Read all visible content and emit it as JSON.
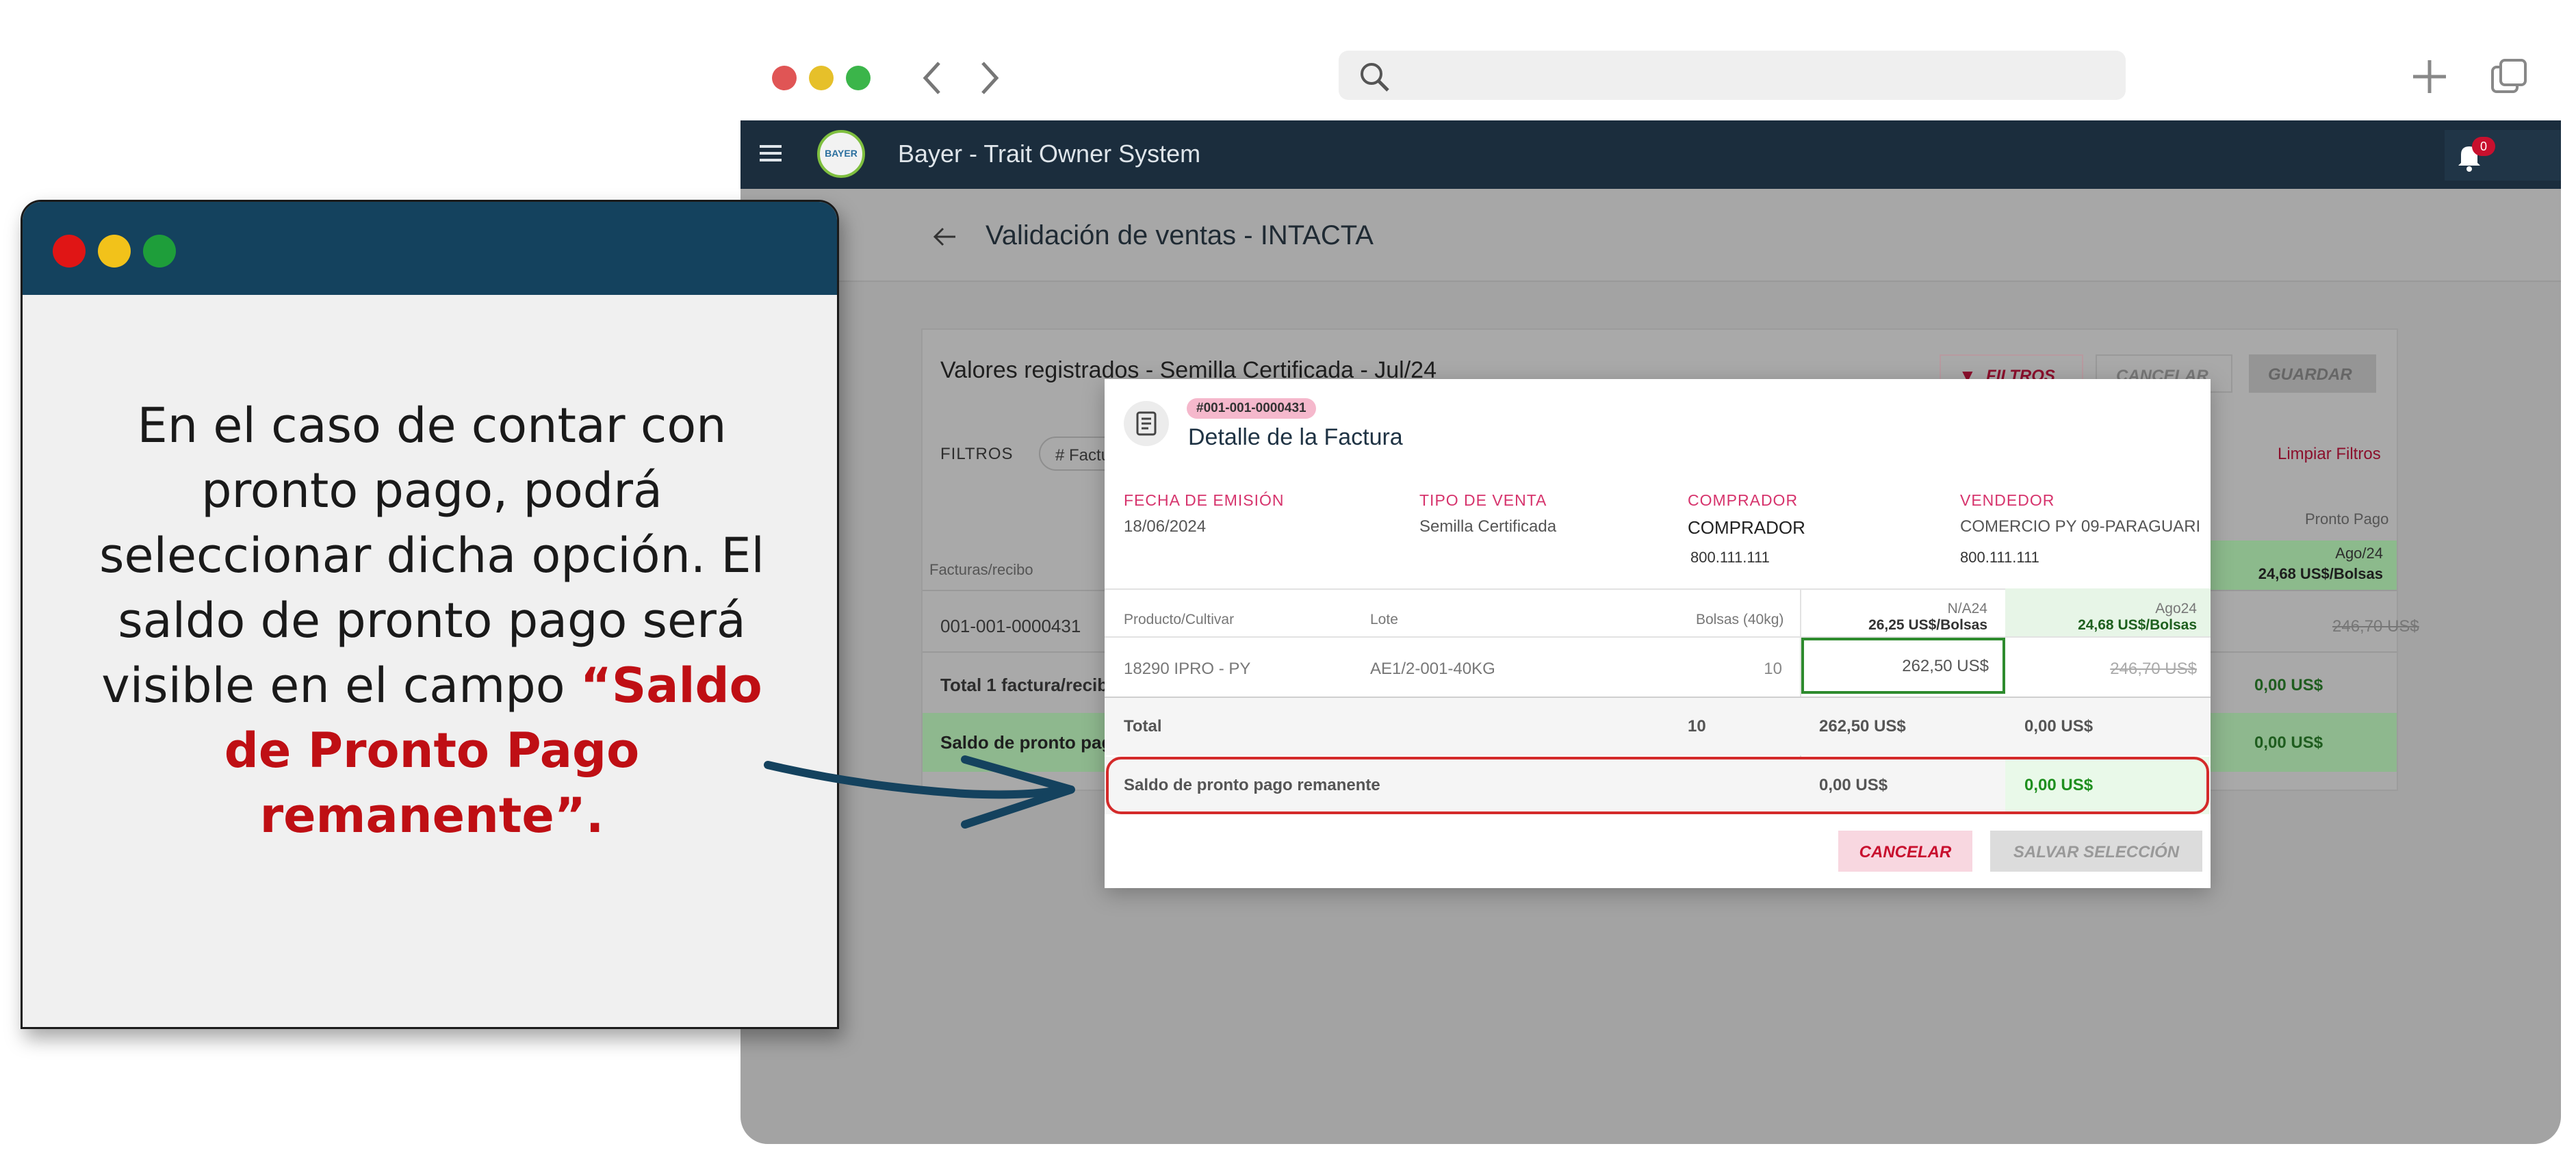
{
  "tutorial": {
    "text": "En el caso de contar con pronto pago, podrá seleccionar dicha opción. El saldo de pronto pago será visible en el campo",
    "highlight": "“Saldo de Pronto Pago remanente”."
  },
  "app": {
    "title": "Bayer - Trait Owner System",
    "logo_text": "BAYER",
    "notification_count": "0"
  },
  "page": {
    "title": "Validación de ventas - INTACTA"
  },
  "background_card": {
    "title": "Valores registrados - Semilla Certificada - Jul/24",
    "filtros_button": "FILTROS",
    "cancelar_button": "CANCELAR",
    "guardar_button": "GUARDAR",
    "filters_label": "FILTROS",
    "filter_chip": "# Factu",
    "limpiar_filtros": "Limpiar Filtros",
    "pronto_pago_header": "Pronto Pago",
    "ago_header": "Ago/24",
    "ago_rate": "24,68 US$/Bolsas",
    "facturas_header": "Facturas/recibo",
    "row_invoice": "001-001-0000431",
    "row_value": "246,70 US$",
    "total_label": "Total 1 factura/recibo",
    "total_value": "0,00 US$",
    "saldo_label": "Saldo de pronto pago",
    "saldo_value": "0,00 US$"
  },
  "modal": {
    "invoice_badge": "#001-001-0000431",
    "title": "Detalle de la Factura",
    "fields": {
      "fecha_label": "FECHA DE EMISIÓN",
      "fecha_value": "18/06/2024",
      "tipo_label": "TIPO DE VENTA",
      "tipo_value": "Semilla Certificada",
      "comprador_label": "COMPRADOR",
      "comprador_value": "COMPRADOR",
      "comprador_id": "800.111.111",
      "vendedor_label": "VENDEDOR",
      "vendedor_value": "COMERCIO PY 09-PARAGUARI",
      "vendedor_id": "800.111.111"
    },
    "table": {
      "col_producto": "Producto/Cultivar",
      "col_lote": "Lote",
      "col_bolsas": "Bolsas (40kg)",
      "col_na24": "N/A24",
      "col_na24_rate": "26,25 US$/Bolsas",
      "col_ago24": "Ago24",
      "col_ago24_rate": "24,68 US$/Bolsas",
      "row_producto": "18290 IPRO - PY",
      "row_lote": "AE1/2-001-40KG",
      "row_bolsas": "10",
      "row_na24": "262,50 US$",
      "row_ago24": "246,70 US$",
      "total_label": "Total",
      "total_bolsas": "10",
      "total_na24": "262,50 US$",
      "total_ago24": "0,00 US$",
      "saldo_label": "Saldo de pronto pago remanente",
      "saldo_na24": "0,00 US$",
      "saldo_ago24": "0,00 US$"
    },
    "cancel_button": "CANCELAR",
    "save_button": "SALVAR SELECCIÓN"
  },
  "colors": {
    "appbar": "#1b2d3d",
    "accent_pink": "#d6336c",
    "highlight_red": "#d42a2a",
    "selected_green": "#2e8b2e",
    "arrow": "#14425e"
  }
}
